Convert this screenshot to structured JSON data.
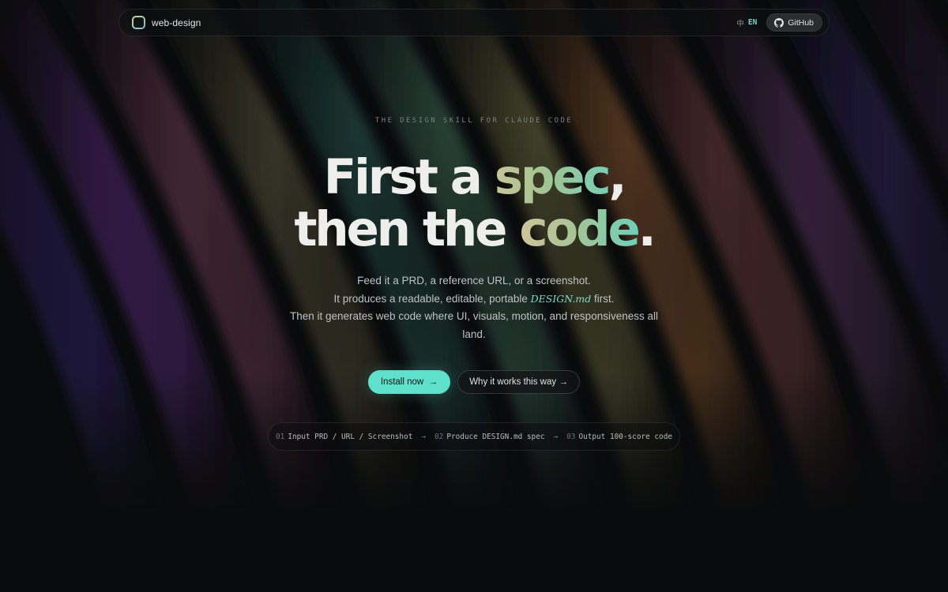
{
  "nav": {
    "brand": "web-design",
    "lang_zh": "中",
    "lang_en": "EN",
    "github_label": "GitHub",
    "icons": {
      "logo": "logo-icon",
      "github": "github-icon"
    }
  },
  "hero": {
    "eyebrow": "THE DESIGN SKILL FOR CLAUDE CODE",
    "headline": {
      "line1_a": "First a ",
      "line1_accent": "spec",
      "line1_b": ",",
      "line2_a": "then the ",
      "line2_accent": "code",
      "line2_b": "."
    },
    "sub": {
      "line1": "Feed it a PRD, a reference URL, or a screenshot.",
      "line2_a": "It produces a readable, editable, portable ",
      "line2_em": "DESIGN.md",
      "line2_b": " first.",
      "line3": "Then it generates web code where UI, visuals, motion, and responsiveness all land."
    },
    "cta_primary": "Install now",
    "cta_primary_arrow": "→",
    "cta_secondary": "Why it works this way",
    "cta_secondary_arrow": "→"
  },
  "steps": [
    {
      "num": "01",
      "label": "Input PRD / URL / Screenshot"
    },
    {
      "num": "02",
      "label": "Produce DESIGN.md spec"
    },
    {
      "num": "03",
      "label": "Output 100-score code"
    }
  ],
  "steps_separator": "→",
  "colors": {
    "background": "#0a0b0c",
    "accent": "#5fe0cc",
    "accent_text": "#7fd8c9",
    "headline_gradient": [
      "#c7c59a",
      "#a6c391",
      "#79cdb3"
    ]
  }
}
